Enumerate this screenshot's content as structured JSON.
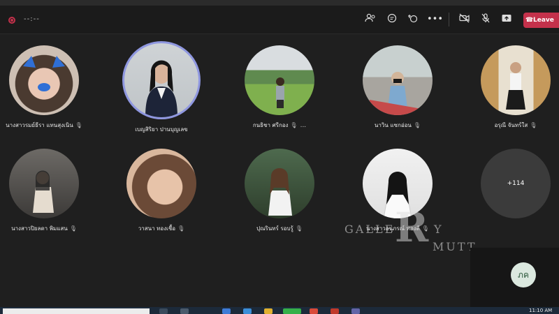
{
  "topbar": {
    "timer": "--:--",
    "leave_label": "Leave",
    "icons": [
      "people-icon",
      "chat-icon",
      "reactions-icon",
      "more-icon",
      "camera-off-icon",
      "mic-off-icon",
      "share-icon"
    ]
  },
  "participants": [
    {
      "name": "นางสาวรมย์ธีรา แทนสุงเนิน",
      "muted": true
    },
    {
      "name": "เบญสิริยา ปานบุญเลข",
      "muted": false,
      "speaking": true
    },
    {
      "name": "กนธิชา ศรีกอง",
      "muted": true,
      "more": "..."
    },
    {
      "name": "นาวิน แซกอ่อน",
      "muted": true
    },
    {
      "name": "อรุณี จันทร์ใส",
      "muted": true
    },
    {
      "name": "นางสาวปิยลดา พิมแสน",
      "muted": true
    },
    {
      "name": "วาสนา ทองเชื้อ",
      "muted": true
    },
    {
      "name": "ปุณรินทร์ รอบรู้",
      "muted": true
    },
    {
      "name": "นางสาวอนุภรณ์ ทองดี",
      "muted": true
    }
  ],
  "overflow": {
    "label": "+114"
  },
  "watermark": {
    "left": "GALLE",
    "mark": "R",
    "y": "Y",
    "right": "MUTT"
  },
  "self_view": {
    "initials": "ภค"
  },
  "taskbar": {
    "clock": "11:10 AM"
  },
  "colors": {
    "leave": "#c4314b",
    "active_ring": "#8f97e0",
    "background": "#1f1f1f"
  }
}
